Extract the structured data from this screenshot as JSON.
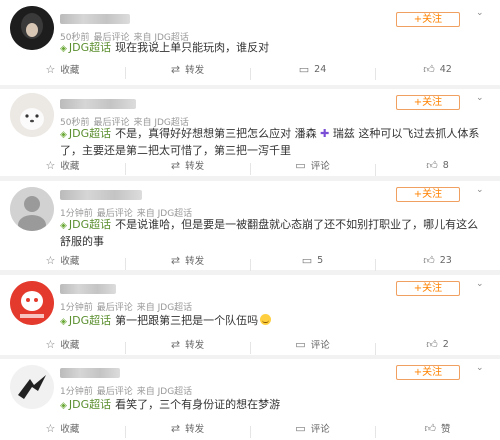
{
  "posts": [
    {
      "time": "50秒前",
      "edited": "最后评论",
      "source": "来自 JDG超话",
      "topic_label": "JDG超话",
      "text": "现在我说上单只能玩肉，谁反对",
      "follow_label": "+关注",
      "actions": {
        "favorite": "收藏",
        "repost": "转发",
        "comments": "24",
        "likes": "42"
      }
    },
    {
      "time": "50秒前",
      "edited": "最后评论",
      "source": "来自 JDG超话",
      "topic_label": "JDG超话",
      "text_a": "不是，真得好好想想第三把怎么应对 潘森",
      "text_b": "瑞兹 这种可以飞过去抓人体系了，主要还是第二把太可惜了，第三把一泻千里",
      "follow_label": "+关注",
      "actions": {
        "favorite": "收藏",
        "repost": "转发",
        "comments": "评论",
        "likes": "8"
      }
    },
    {
      "time": "1分钟前",
      "edited": "最后评论",
      "source": "来自 JDG超话",
      "topic_label": "JDG超话",
      "text": "不是说谁哈，但是要是一被翻盘就心态崩了还不如别打职业了，哪儿有这么舒服的事",
      "follow_label": "+关注",
      "actions": {
        "favorite": "收藏",
        "repost": "转发",
        "comments": "5",
        "likes": "23"
      }
    },
    {
      "time": "1分钟前",
      "edited": "最后评论",
      "source": "来自 JDG超话",
      "topic_label": "JDG超话",
      "text": "第一把跟第三把是一个队伍吗",
      "follow_label": "+关注",
      "actions": {
        "favorite": "收藏",
        "repost": "转发",
        "comments": "评论",
        "likes": "2"
      }
    },
    {
      "time": "1分钟前",
      "edited": "最后评论",
      "source": "来自 JDG超话",
      "topic_label": "JDG超话",
      "text": "看笑了，三个有身份证的想在梦游",
      "follow_label": "+关注",
      "actions": {
        "favorite": "收藏",
        "repost": "转发",
        "comments": "评论",
        "likes": "赞"
      }
    }
  ],
  "icons": {
    "favorite": "star-icon",
    "repost": "repost-icon",
    "comment": "comment-icon",
    "like": "thumb-up-icon",
    "topic": "diamond-icon",
    "more": "chevron-down-icon"
  },
  "colors": {
    "accent": "#ff8200",
    "topic": "#5a8e2e",
    "background": "#f2f2f2"
  }
}
